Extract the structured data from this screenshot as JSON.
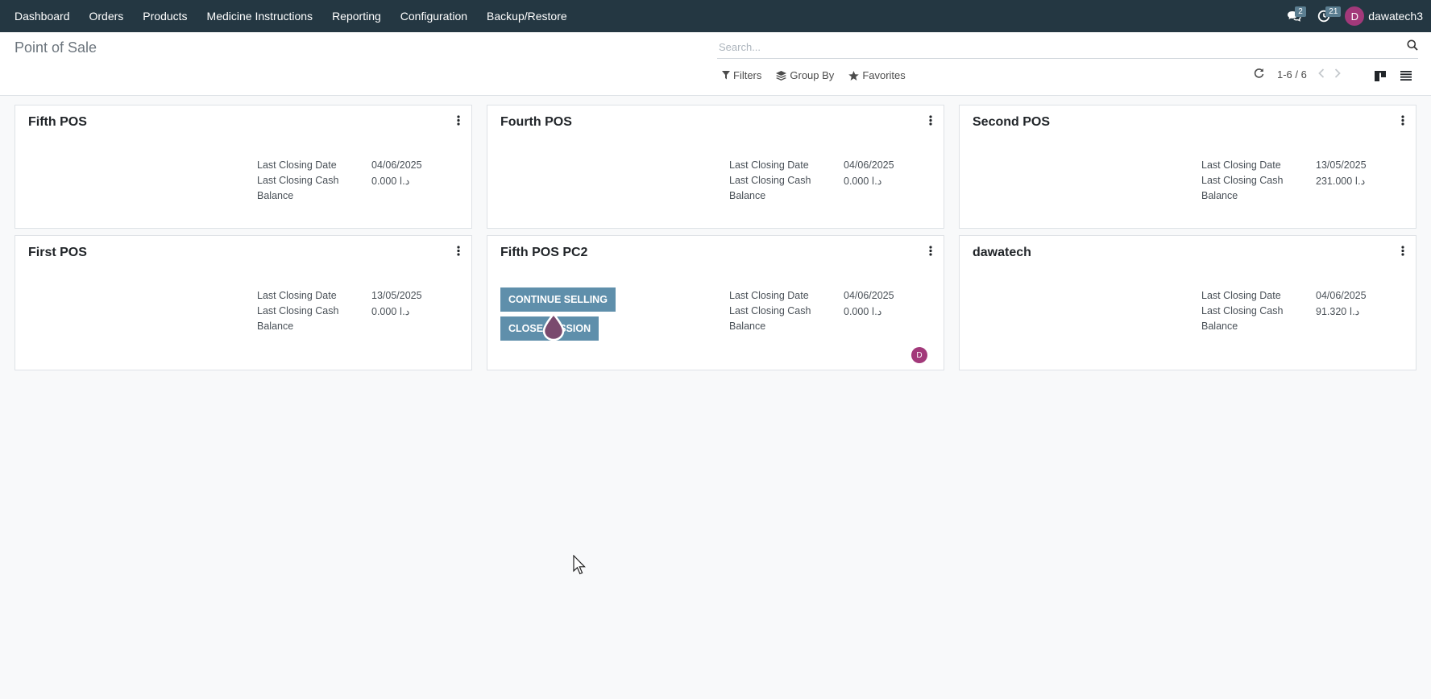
{
  "navbar": {
    "menu": [
      "Dashboard",
      "Orders",
      "Products",
      "Medicine Instructions",
      "Reporting",
      "Configuration",
      "Backup/Restore"
    ],
    "messages_badge": "2",
    "activities_badge": "21",
    "user_initial": "D",
    "user_name": "dawatech3"
  },
  "control_panel": {
    "title": "Point of Sale",
    "search_placeholder": "Search...",
    "filters_label": "Filters",
    "group_by_label": "Group By",
    "favorites_label": "Favorites",
    "pager_value": "1-6 / 6"
  },
  "cards": [
    {
      "name": "Fifth POS",
      "label1": "Last Closing Date",
      "date": "04/06/2025",
      "label2": "Last Closing Cash",
      "cash": "0.000  د.ا",
      "label3": "Balance"
    },
    {
      "name": "Fourth POS",
      "label1": "Last Closing Date",
      "date": "04/06/2025",
      "label2": "Last Closing Cash",
      "cash": "0.000  د.ا",
      "label3": "Balance"
    },
    {
      "name": "Second POS",
      "label1": "Last Closing Date",
      "date": "13/05/2025",
      "label2": "Last Closing Cash",
      "cash": "231.000  د.ا",
      "label3": "Balance"
    },
    {
      "name": "First POS",
      "label1": "Last Closing Date",
      "date": "13/05/2025",
      "label2": "Last Closing Cash",
      "cash": "0.000  د.ا",
      "label3": "Balance"
    },
    {
      "name": "Fifth POS PC2",
      "label1": "Last Closing Date",
      "date": "04/06/2025",
      "label2": "Last Closing Cash",
      "cash": "0.000  د.ا",
      "label3": "Balance",
      "continue_label": "CONTINUE SELLING",
      "close_label": "CLOSE SESSION",
      "avatar_initial": "D"
    },
    {
      "name": "dawatech",
      "label1": "Last Closing Date",
      "date": "04/06/2025",
      "label2": "Last Closing Cash",
      "cash": "91.320  د.ا",
      "label3": "Balance"
    }
  ],
  "colors": {
    "navbar": "#243742",
    "accent_button": "#5f8fab",
    "avatar": "#a2397a",
    "background": "#f8f9fa"
  }
}
